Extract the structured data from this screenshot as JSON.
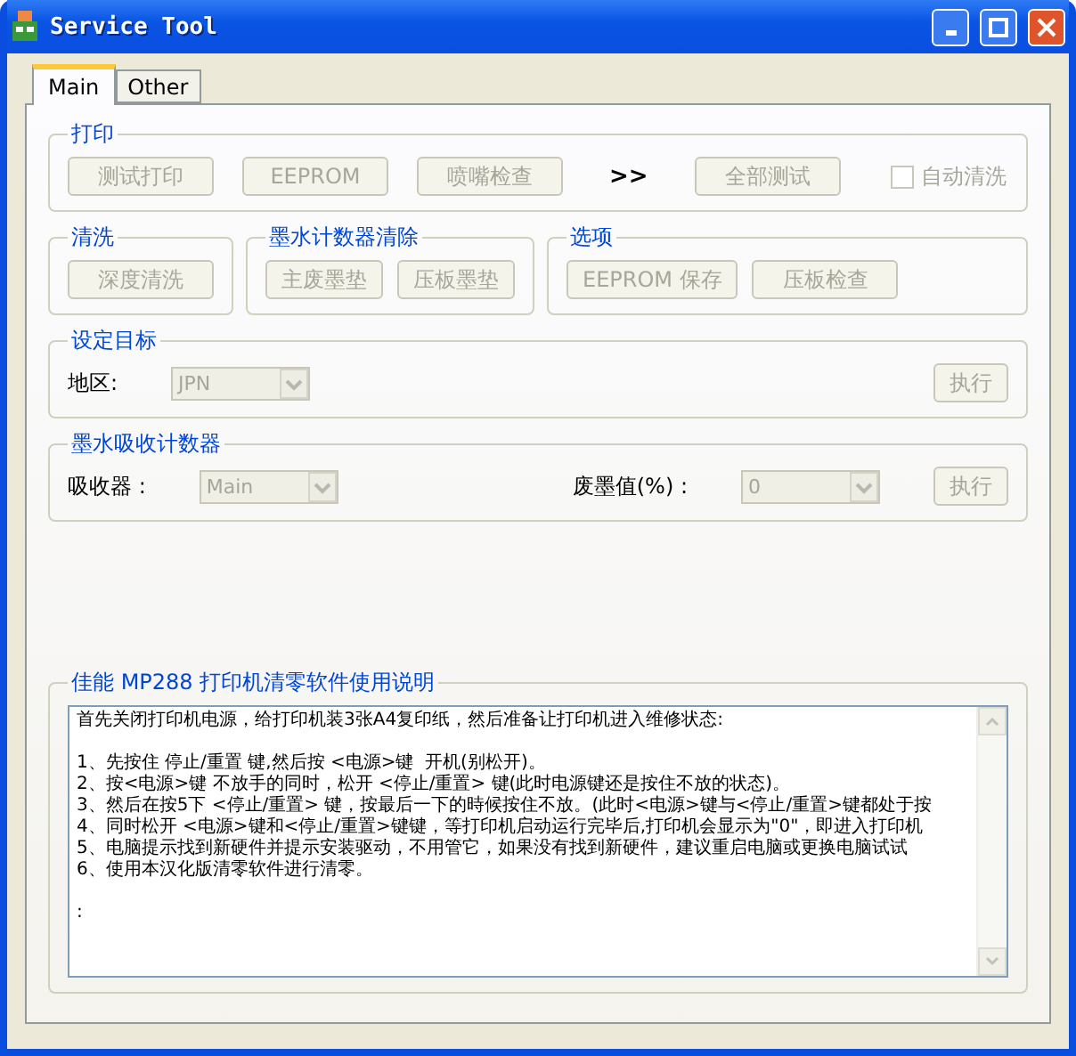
{
  "window": {
    "title": "Service Tool"
  },
  "tabs": [
    {
      "label": "Main",
      "selected": true
    },
    {
      "label": "Other",
      "selected": false
    }
  ],
  "print_group": {
    "title": "打印",
    "buttons": [
      {
        "label": "测试打印",
        "disabled": true
      },
      {
        "label": "EEPROM",
        "disabled": true
      },
      {
        "label": "喷嘴检查",
        "disabled": true
      }
    ],
    "arrow": ">>",
    "all_test": {
      "label": "全部测试",
      "disabled": true
    },
    "auto_clean": {
      "label": "自动清洗",
      "checked": false,
      "disabled": true
    }
  },
  "middle_groups": [
    {
      "title": "清洗",
      "buttons": [
        {
          "label": "深度清洗",
          "disabled": true
        }
      ]
    },
    {
      "title": "墨水计数器清除",
      "buttons": [
        {
          "label": "主废墨垫",
          "disabled": true
        },
        {
          "label": "压板墨垫",
          "disabled": true
        }
      ]
    },
    {
      "title": "选项",
      "buttons": [
        {
          "label": "EEPROM 保存",
          "disabled": true
        },
        {
          "label": "压板检查",
          "disabled": true
        }
      ]
    }
  ],
  "target": {
    "title": "设定目标",
    "label": "地区:",
    "select": {
      "value": "JPN",
      "disabled": true
    },
    "button": {
      "label": "执行",
      "disabled": true
    }
  },
  "ink_counter": {
    "title": "墨水吸收计数器",
    "absorber_label": "吸收器 :",
    "absorber": {
      "value": "Main",
      "disabled": true
    },
    "waste_label": "废墨值(%) :",
    "waste": {
      "value": "0",
      "disabled": true
    },
    "button": {
      "label": "执行",
      "disabled": true
    }
  },
  "instructions": {
    "title": "佳能 MP288 打印机清零软件使用说明",
    "intro": "首先关闭打印机电源，给打印机装3张A4复印纸，然后准备让打印机进入维修状态:",
    "steps": [
      "1、先按住 停止/重置 键,然后按 <电源>键  开机(别松开)。",
      "2、按<电源>键 不放手的同时，松开 <停止/重置> 键(此时电源键还是按住不放的状态)。",
      "3、然后在按5下 <停止/重置> 键，按最后一下的時候按住不放。(此时<电源>键与<停止/重置>键都处于按",
      "4、同时松开 <电源>键和<停止/重置>键键，等打印机启动运行完毕后,打印机会显示为\"0\"，即进入打印机",
      "5、电脑提示找到新硬件并提示安装驱动，不用管它，如果没有找到新硬件，建议重启电脑或更换电脑试试",
      "6、使用本汉化版清零软件进行清零。"
    ],
    "trailing": ":"
  }
}
